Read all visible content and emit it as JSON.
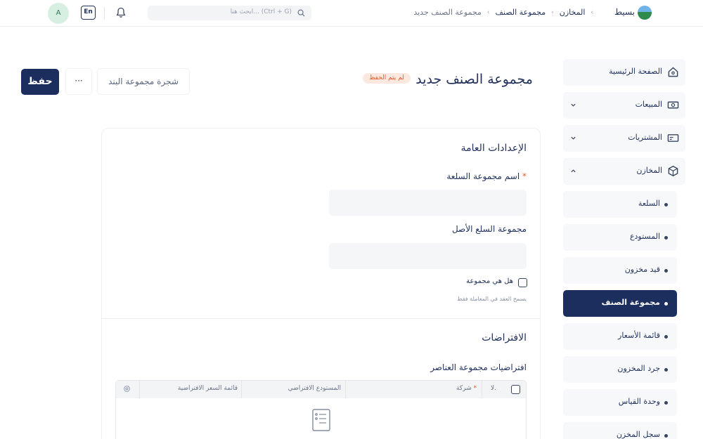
{
  "topbar": {
    "brand": "بسيط",
    "breadcrumbs": [
      "المخازن",
      "مجموعة الصنف",
      "مجموعة الصنف جديد"
    ],
    "search_placeholder": "ابحث هنا... (Ctrl + G)",
    "lang": "En",
    "avatar": "A"
  },
  "sidebar": {
    "items": [
      {
        "label": "الصفحة الرئيسية",
        "icon": "home-icon"
      },
      {
        "label": "المبيعات",
        "icon": "money-icon"
      },
      {
        "label": "المشتريات",
        "icon": "card-icon"
      },
      {
        "label": "المخازن",
        "icon": "box-icon"
      }
    ],
    "subitems": [
      "السلعة",
      "المستودع",
      "قيد مخزون",
      "مجموعة الصنف",
      "قائمة الأسعار",
      "جرد المخزون",
      "وحدة القياس",
      "سجل المخزن"
    ],
    "active_sub": "مجموعة الصنف"
  },
  "header": {
    "title": "مجموعة الصنف جديد",
    "badge": "لم يتم الحفظ",
    "tree_button": "شجرة مجموعة البند",
    "more_button": "···",
    "save_button": "حفظ"
  },
  "form": {
    "general_title": "الإعدادات العامة",
    "item_group_name_label": "اسم مجموعة السلعة",
    "required_mark": "*",
    "item_group_name_value": "",
    "parent_group_label": "مجموعة السلع الأصل",
    "parent_group_value": "",
    "is_group_label": "هل هي مجموعة",
    "is_group_hint": "يسمح العقد في المعاملة فقط",
    "is_group_checked": false,
    "defaults_title": "الافتراضات",
    "defaults_table_label": "افتراضيات مجموعة العناصر",
    "table_headers": {
      "no": "لا.",
      "company": "شركة",
      "default_warehouse": "المستودع الافتراضي",
      "default_price_list": "قائمة السعر الافتراضية"
    }
  },
  "colors": {
    "primary": "#1c2e5e",
    "badge_bg": "#fde8df",
    "badge_text": "#e05a2b",
    "avatar_bg": "#d7efe1"
  }
}
